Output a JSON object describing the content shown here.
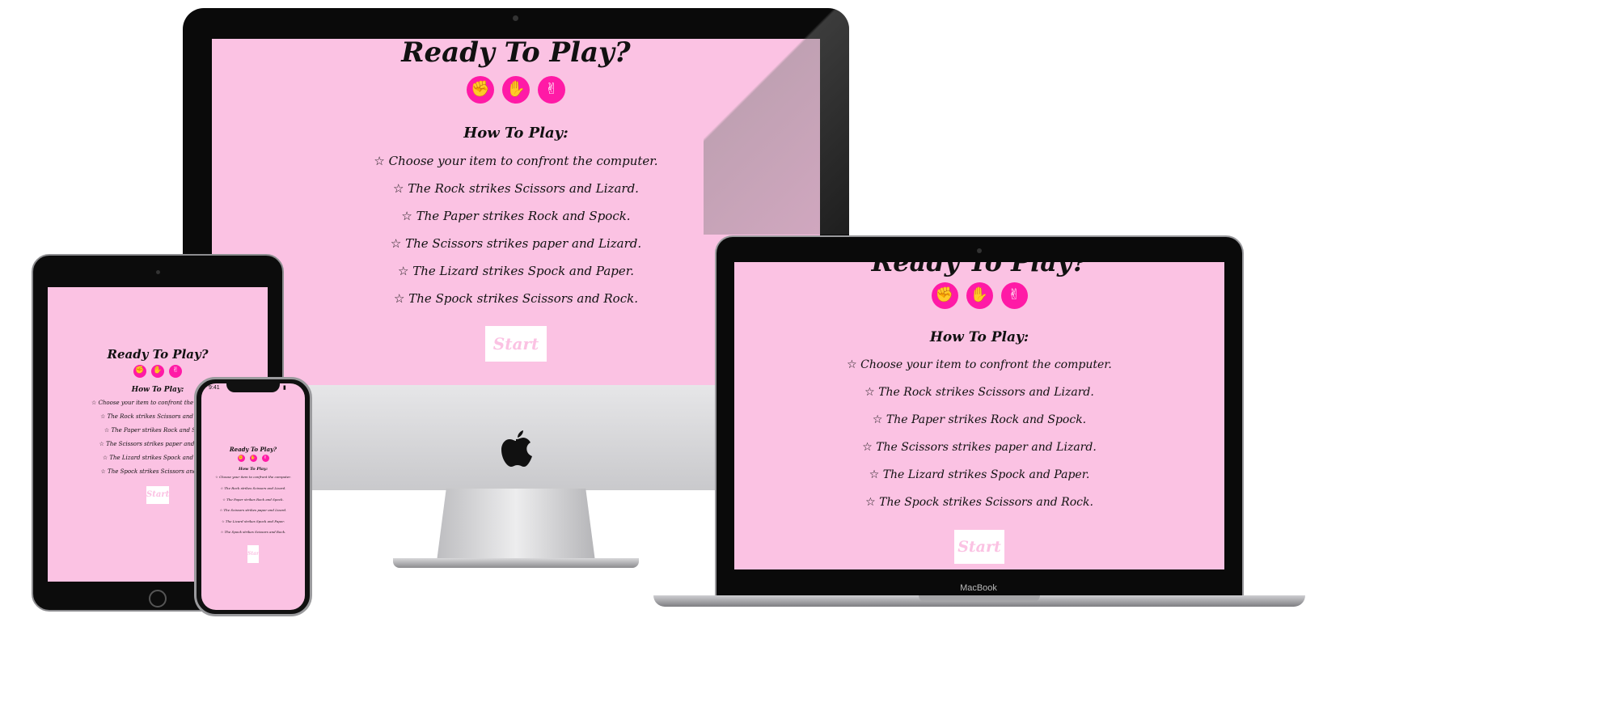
{
  "app": {
    "title": "Ready To Play?",
    "how_to_heading": "How To Play:",
    "rules": [
      "Choose your item to confront the computer.",
      "The Rock strikes Scissors and Lizard.",
      "The Paper strikes Rock and Spock.",
      "The Scissors strikes paper and Lizard.",
      "The Lizard strikes Spock and Paper.",
      "The Spock strikes Scissors and Rock."
    ],
    "start_label": "Start",
    "icons": [
      "rock-icon",
      "paper-icon",
      "scissors-icon"
    ]
  },
  "devices": {
    "laptop_brand": "MacBook",
    "phone_status_time": "9:41"
  },
  "colors": {
    "background": "#fbc2e3",
    "accent": "#ff1aa6",
    "text": "#111111",
    "button_bg": "#ffffff"
  }
}
